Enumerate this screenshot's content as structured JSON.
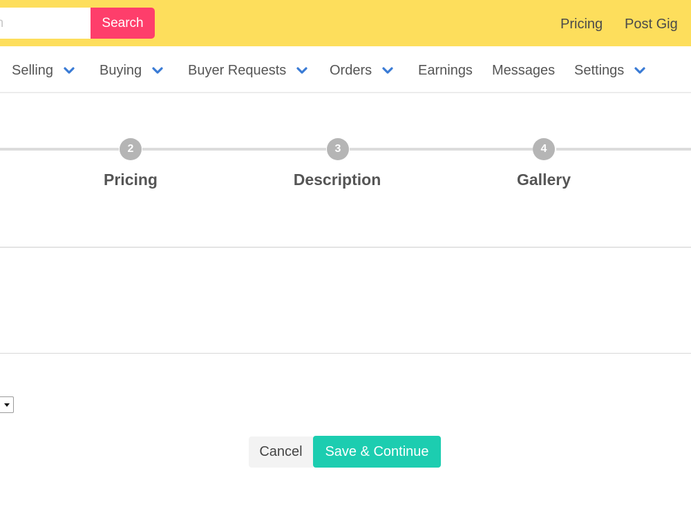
{
  "header": {
    "search_placeholder": "gn",
    "search_button": "Search",
    "links": [
      "Pricing",
      "Post Gig"
    ]
  },
  "nav": {
    "items": [
      {
        "label": "Selling",
        "dropdown": true
      },
      {
        "label": "Buying",
        "dropdown": true
      },
      {
        "label": "Buyer Requests",
        "dropdown": true
      },
      {
        "label": "Orders",
        "dropdown": true
      },
      {
        "label": "Earnings",
        "dropdown": false
      },
      {
        "label": "Messages",
        "dropdown": false
      },
      {
        "label": "Settings",
        "dropdown": true
      }
    ]
  },
  "stepper": {
    "steps": [
      {
        "number": "2",
        "label": "Pricing"
      },
      {
        "number": "3",
        "label": "Description"
      },
      {
        "number": "4",
        "label": "Gallery"
      }
    ]
  },
  "form": {
    "cancel_label": "Cancel",
    "save_label": "Save & Continue"
  },
  "colors": {
    "topbar": "#fdde5c",
    "search_button": "#fe3e6b",
    "save_button": "#1ccdb0",
    "chevron": "#3a7bd5",
    "step_inactive": "#b5b5b5"
  }
}
